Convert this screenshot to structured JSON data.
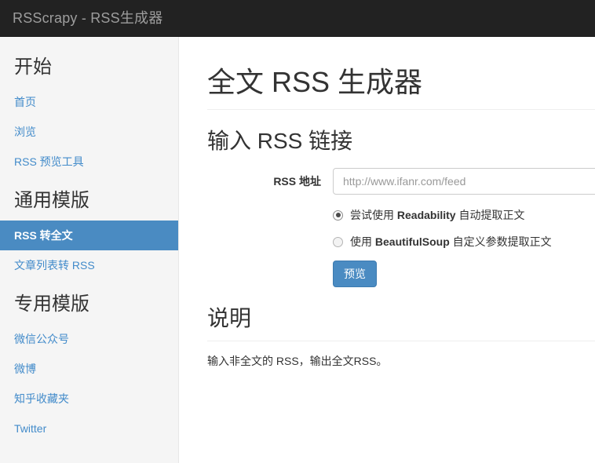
{
  "navbar": {
    "brand": "RSScrapy - RSS生成器"
  },
  "sidebar": {
    "groups": [
      {
        "heading": "开始",
        "items": [
          {
            "label": "首页",
            "active": false
          },
          {
            "label": "浏览",
            "active": false
          },
          {
            "label": "RSS 预览工具",
            "active": false
          }
        ]
      },
      {
        "heading": "通用模版",
        "items": [
          {
            "label": "RSS 转全文",
            "active": true
          },
          {
            "label": "文章列表转 RSS",
            "active": false
          }
        ]
      },
      {
        "heading": "专用模版",
        "items": [
          {
            "label": "微信公众号",
            "active": false
          },
          {
            "label": "微博",
            "active": false
          },
          {
            "label": "知乎收藏夹",
            "active": false
          },
          {
            "label": "Twitter",
            "active": false
          }
        ]
      }
    ]
  },
  "main": {
    "page_title": "全文 RSS 生成器",
    "input_section": {
      "title": "输入 RSS 链接",
      "url_label": "RSS 地址",
      "url_value": "",
      "url_placeholder": "http://www.ifanr.com/feed",
      "options": [
        {
          "prefix": "尝试使用 ",
          "strong": "Readability",
          "suffix": " 自动提取正文",
          "selected": true
        },
        {
          "prefix": "使用 ",
          "strong": "BeautifulSoup",
          "suffix": " 自定义参数提取正文",
          "selected": false
        }
      ],
      "submit_label": "预览"
    },
    "description_section": {
      "title": "说明",
      "text": "输入非全文的 RSS，输出全文RSS。"
    }
  },
  "colors": {
    "navbar_bg": "#222222",
    "navbar_text": "#9d9d9d",
    "sidebar_bg": "#f5f5f5",
    "link": "#428bca",
    "accent": "#4a8bc2",
    "text": "#333333"
  }
}
